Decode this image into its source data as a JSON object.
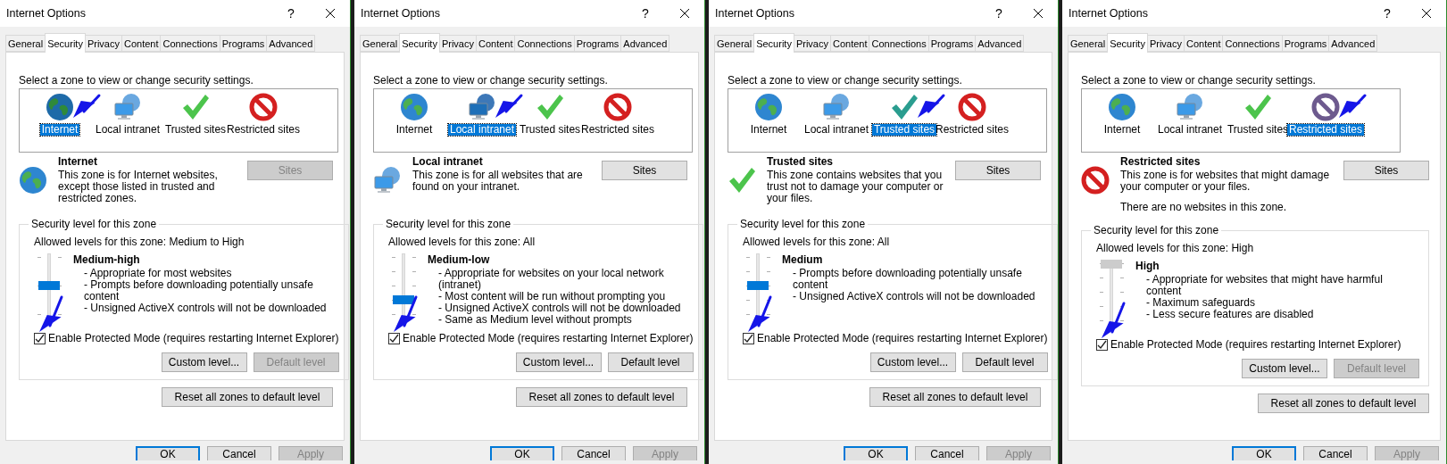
{
  "dialogs": [
    {
      "title": "Internet Options",
      "help": "?",
      "tabs": [
        {
          "label": "General",
          "selected": false
        },
        {
          "label": "Security",
          "selected": true
        },
        {
          "label": "Privacy",
          "selected": false
        },
        {
          "label": "Content",
          "selected": false
        },
        {
          "label": "Connections",
          "selected": false
        },
        {
          "label": "Programs",
          "selected": false
        },
        {
          "label": "Advanced",
          "selected": false
        }
      ],
      "prompt": "Select a zone to view or change security settings.",
      "zones": [
        {
          "label": "Internet",
          "kind": "globe",
          "selected": true,
          "arrow": true
        },
        {
          "label": "Local intranet",
          "kind": "intranet",
          "selected": false,
          "arrow": false
        },
        {
          "label": "Trusted sites",
          "kind": "check",
          "selected": false,
          "arrow": false
        },
        {
          "label": "Restricted sites",
          "kind": "restricted",
          "selected": false,
          "arrow": false
        }
      ],
      "zone_info": {
        "kind": "globe",
        "name": "Internet",
        "description": [
          "This zone is for Internet websites, except those listed in trusted and restricted zones."
        ]
      },
      "sites_button": {
        "label": "Sites",
        "disabled": true
      },
      "level_group": {
        "legend": "Security level for this zone",
        "allowed": "Allowed levels for this zone: Medium to High",
        "slider": {
          "kind": "three_step",
          "level": 0.5,
          "disabled": false
        },
        "level_name": "Medium-high",
        "bullets": [
          "- Appropriate for most websites",
          "- Prompts before downloading potentially unsafe content",
          "- Unsigned ActiveX controls will not be downloaded"
        ]
      },
      "protected_mode": {
        "label": "Enable Protected Mode (requires restarting Internet Explorer)",
        "checked": true,
        "arrow": true
      },
      "custom_button": {
        "label": "Custom level...",
        "disabled": false
      },
      "default_button": {
        "label": "Default level",
        "disabled": true
      },
      "reset_button": {
        "label": "Reset all zones to default level"
      },
      "footer": [
        {
          "label": "OK",
          "kind": "default",
          "disabled": false
        },
        {
          "label": "Cancel",
          "kind": "normal",
          "disabled": false
        },
        {
          "label": "Apply",
          "kind": "normal",
          "disabled": true
        }
      ]
    },
    {
      "title": "Internet Options",
      "help": "?",
      "tabs": [
        {
          "label": "General",
          "selected": false
        },
        {
          "label": "Security",
          "selected": true
        },
        {
          "label": "Privacy",
          "selected": false
        },
        {
          "label": "Content",
          "selected": false
        },
        {
          "label": "Connections",
          "selected": false
        },
        {
          "label": "Programs",
          "selected": false
        },
        {
          "label": "Advanced",
          "selected": false
        }
      ],
      "prompt": "Select a zone to view or change security settings.",
      "zones": [
        {
          "label": "Internet",
          "kind": "globe",
          "selected": false,
          "arrow": false
        },
        {
          "label": "Local intranet",
          "kind": "intranet",
          "selected": true,
          "arrow": true
        },
        {
          "label": "Trusted sites",
          "kind": "check",
          "selected": false,
          "arrow": false
        },
        {
          "label": "Restricted sites",
          "kind": "restricted",
          "selected": false,
          "arrow": false
        }
      ],
      "zone_info": {
        "kind": "intranet",
        "name": "Local intranet",
        "description": [
          "This zone is for all websites that are found on your intranet."
        ]
      },
      "sites_button": {
        "label": "Sites",
        "disabled": false
      },
      "level_group": {
        "legend": "Security level for this zone",
        "allowed": "Allowed levels for this zone: All",
        "slider": {
          "kind": "five_step",
          "level": 0.25,
          "disabled": false
        },
        "level_name": "Medium-low",
        "bullets": [
          "- Appropriate for websites on your local network (intranet)",
          "- Most content will be run without prompting you",
          "- Unsigned ActiveX controls will not be downloaded",
          "- Same as Medium level without prompts"
        ]
      },
      "protected_mode": {
        "label": "Enable Protected Mode (requires restarting Internet Explorer)",
        "checked": true,
        "arrow": true
      },
      "custom_button": {
        "label": "Custom level...",
        "disabled": false
      },
      "default_button": {
        "label": "Default level",
        "disabled": false
      },
      "reset_button": {
        "label": "Reset all zones to default level"
      },
      "footer": [
        {
          "label": "OK",
          "kind": "default",
          "disabled": false
        },
        {
          "label": "Cancel",
          "kind": "normal",
          "disabled": false
        },
        {
          "label": "Apply",
          "kind": "normal",
          "disabled": true
        }
      ]
    },
    {
      "title": "Internet Options",
      "help": "?",
      "tabs": [
        {
          "label": "General",
          "selected": false
        },
        {
          "label": "Security",
          "selected": true
        },
        {
          "label": "Privacy",
          "selected": false
        },
        {
          "label": "Content",
          "selected": false
        },
        {
          "label": "Connections",
          "selected": false
        },
        {
          "label": "Programs",
          "selected": false
        },
        {
          "label": "Advanced",
          "selected": false
        }
      ],
      "prompt": "Select a zone to view or change security settings.",
      "zones": [
        {
          "label": "Internet",
          "kind": "globe",
          "selected": false,
          "arrow": false
        },
        {
          "label": "Local intranet",
          "kind": "intranet",
          "selected": false,
          "arrow": false
        },
        {
          "label": "Trusted sites",
          "kind": "check",
          "selected": true,
          "arrow": true
        },
        {
          "label": "Restricted sites",
          "kind": "restricted",
          "selected": false,
          "arrow": false
        }
      ],
      "zone_info": {
        "kind": "check",
        "name": "Trusted sites",
        "description": [
          "This zone contains websites that you trust not to damage your computer or your files."
        ]
      },
      "sites_button": {
        "label": "Sites",
        "disabled": false
      },
      "level_group": {
        "legend": "Security level for this zone",
        "allowed": "Allowed levels for this zone: All",
        "slider": {
          "kind": "five_step",
          "level": 0.5,
          "disabled": false
        },
        "level_name": "Medium",
        "bullets": [
          "- Prompts before downloading potentially unsafe content",
          "- Unsigned ActiveX controls will not be downloaded"
        ]
      },
      "protected_mode": {
        "label": "Enable Protected Mode (requires restarting Internet Explorer)",
        "checked": true,
        "arrow": true
      },
      "custom_button": {
        "label": "Custom level...",
        "disabled": false
      },
      "default_button": {
        "label": "Default level",
        "disabled": false
      },
      "reset_button": {
        "label": "Reset all zones to default level"
      },
      "footer": [
        {
          "label": "OK",
          "kind": "default",
          "disabled": false
        },
        {
          "label": "Cancel",
          "kind": "normal",
          "disabled": false
        },
        {
          "label": "Apply",
          "kind": "normal",
          "disabled": true
        }
      ]
    },
    {
      "title": "Internet Options",
      "help": "?",
      "tabs": [
        {
          "label": "General",
          "selected": false
        },
        {
          "label": "Security",
          "selected": true
        },
        {
          "label": "Privacy",
          "selected": false
        },
        {
          "label": "Content",
          "selected": false
        },
        {
          "label": "Connections",
          "selected": false
        },
        {
          "label": "Programs",
          "selected": false
        },
        {
          "label": "Advanced",
          "selected": false
        }
      ],
      "prompt": "Select a zone to view or change security settings.",
      "zones": [
        {
          "label": "Internet",
          "kind": "globe",
          "selected": false,
          "arrow": false
        },
        {
          "label": "Local intranet",
          "kind": "intranet",
          "selected": false,
          "arrow": false
        },
        {
          "label": "Trusted sites",
          "kind": "check",
          "selected": false,
          "arrow": false
        },
        {
          "label": "Restricted sites",
          "kind": "restricted",
          "selected": true,
          "arrow": true
        }
      ],
      "zone_info": {
        "kind": "restricted",
        "name": "Restricted sites",
        "description": [
          "This zone is for websites that might damage your computer or your files.",
          "There are no websites in this zone."
        ]
      },
      "sites_button": {
        "label": "Sites",
        "disabled": false
      },
      "level_group": {
        "legend": "Security level for this zone",
        "allowed": "Allowed levels for this zone: High",
        "slider": {
          "kind": "five_step",
          "level": 1,
          "disabled": true
        },
        "level_name": "High",
        "bullets": [
          "- Appropriate for websites that might have harmful content",
          "- Maximum safeguards",
          "- Less secure features are disabled"
        ]
      },
      "protected_mode": {
        "label": "Enable Protected Mode (requires restarting Internet Explorer)",
        "checked": true,
        "arrow": true
      },
      "custom_button": {
        "label": "Custom level...",
        "disabled": false
      },
      "default_button": {
        "label": "Default level",
        "disabled": true
      },
      "reset_button": {
        "label": "Reset all zones to default level"
      },
      "footer": [
        {
          "label": "OK",
          "kind": "default",
          "disabled": false
        },
        {
          "label": "Cancel",
          "kind": "normal",
          "disabled": false
        },
        {
          "label": "Apply",
          "kind": "normal",
          "disabled": true
        }
      ]
    }
  ]
}
